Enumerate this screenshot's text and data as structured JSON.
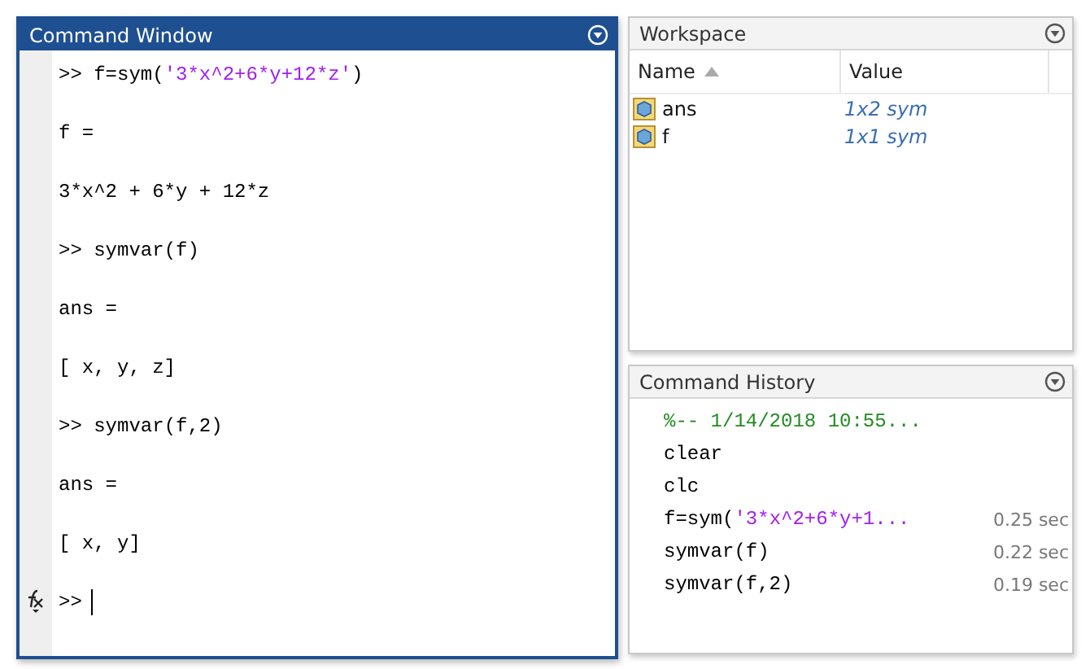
{
  "command_window": {
    "title": "Command Window",
    "lines": [
      {
        "parts": [
          {
            "text": ">> ",
            "kind": "code"
          },
          {
            "text": "f=sym(",
            "kind": "code"
          },
          {
            "text": "'3*x^2+6*y+12*z'",
            "kind": "string"
          },
          {
            "text": ")",
            "kind": "code"
          }
        ]
      },
      {
        "parts": [
          {
            "text": "f =",
            "kind": "code"
          }
        ]
      },
      {
        "parts": [
          {
            "text": "3*x^2 + 6*y + 12*z",
            "kind": "code"
          }
        ]
      },
      {
        "parts": [
          {
            "text": ">> ",
            "kind": "code"
          },
          {
            "text": "symvar(f)",
            "kind": "code"
          }
        ]
      },
      {
        "parts": [
          {
            "text": "ans =",
            "kind": "code"
          }
        ]
      },
      {
        "parts": [
          {
            "text": "[ x, y, z]",
            "kind": "code"
          }
        ]
      },
      {
        "parts": [
          {
            "text": ">> ",
            "kind": "code"
          },
          {
            "text": "symvar(f,2)",
            "kind": "code"
          }
        ]
      },
      {
        "parts": [
          {
            "text": "ans =",
            "kind": "code"
          }
        ]
      },
      {
        "parts": [
          {
            "text": "[ x, y]",
            "kind": "code"
          }
        ]
      }
    ],
    "prompt": ">>"
  },
  "workspace": {
    "title": "Workspace",
    "columns": [
      "Name",
      "Value"
    ],
    "rows": [
      {
        "name": "ans",
        "value": "1x2 sym"
      },
      {
        "name": "f",
        "value": "1x1 sym"
      }
    ]
  },
  "command_history": {
    "title": "Command History",
    "entries": [
      {
        "parts": [
          {
            "text": "%-- 1/14/2018 10:55...",
            "kind": "comment"
          }
        ]
      },
      {
        "parts": [
          {
            "text": "clear",
            "kind": "code"
          }
        ]
      },
      {
        "parts": [
          {
            "text": "clc",
            "kind": "code"
          }
        ]
      },
      {
        "parts": [
          {
            "text": "f=sym(",
            "kind": "code"
          },
          {
            "text": "'3*x^2+6*y+1...",
            "kind": "string"
          }
        ],
        "time": "0.25 sec"
      },
      {
        "parts": [
          {
            "text": "symvar(f)",
            "kind": "code"
          }
        ],
        "time": "0.22 sec"
      },
      {
        "parts": [
          {
            "text": "symvar(f,2)",
            "kind": "code"
          }
        ],
        "time": "0.19 sec"
      }
    ]
  }
}
